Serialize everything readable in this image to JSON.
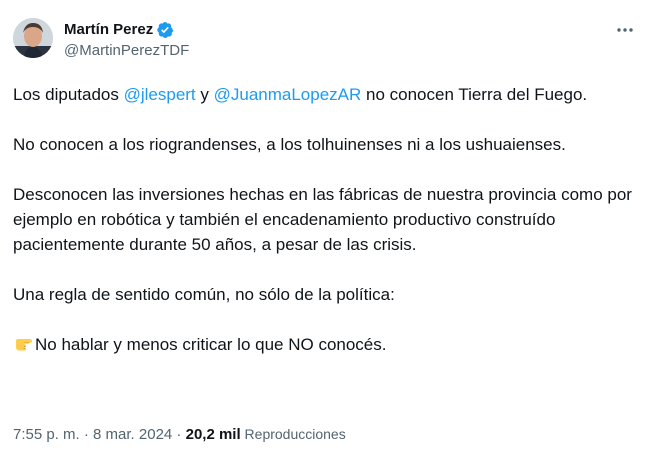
{
  "author": {
    "display_name": "Martín Perez",
    "handle": "@MartinPerezTDF"
  },
  "colors": {
    "link": "#1d9bf0",
    "verified": "#1d9bf0",
    "text": "#0f1419",
    "secondary": "#536471"
  },
  "icons": {
    "verified": "verified-badge-icon",
    "more": "more-horizontal-icon",
    "emoji": "pointing-right-hand-emoji"
  },
  "tweet": {
    "p1_before": "Los diputados ",
    "mention1": "@jlespert",
    "p1_middle": " y ",
    "mention2": "@JuanmaLopezAR",
    "p1_after": " no conocen Tierra del Fuego.",
    "p2": "No conocen a los riograndenses, a los tolhuinenses ni a los ushuaienses.",
    "p3": "Desconocen las inversiones hechas en las fábricas de nuestra provincia como por ejemplo en robótica y también el encadenamiento productivo construído pacientemente durante 50 años, a pesar de las crisis.",
    "p4": "Una regla de sentido común, no sólo de la política:",
    "p5": "No hablar y menos criticar lo que NO conocés."
  },
  "meta": {
    "time": "7:55 p. m.",
    "separator": " · ",
    "date": "8 mar. 2024",
    "separator2": " · ",
    "views_count": "20,2 mil",
    "views_label": " Reproducciones"
  }
}
